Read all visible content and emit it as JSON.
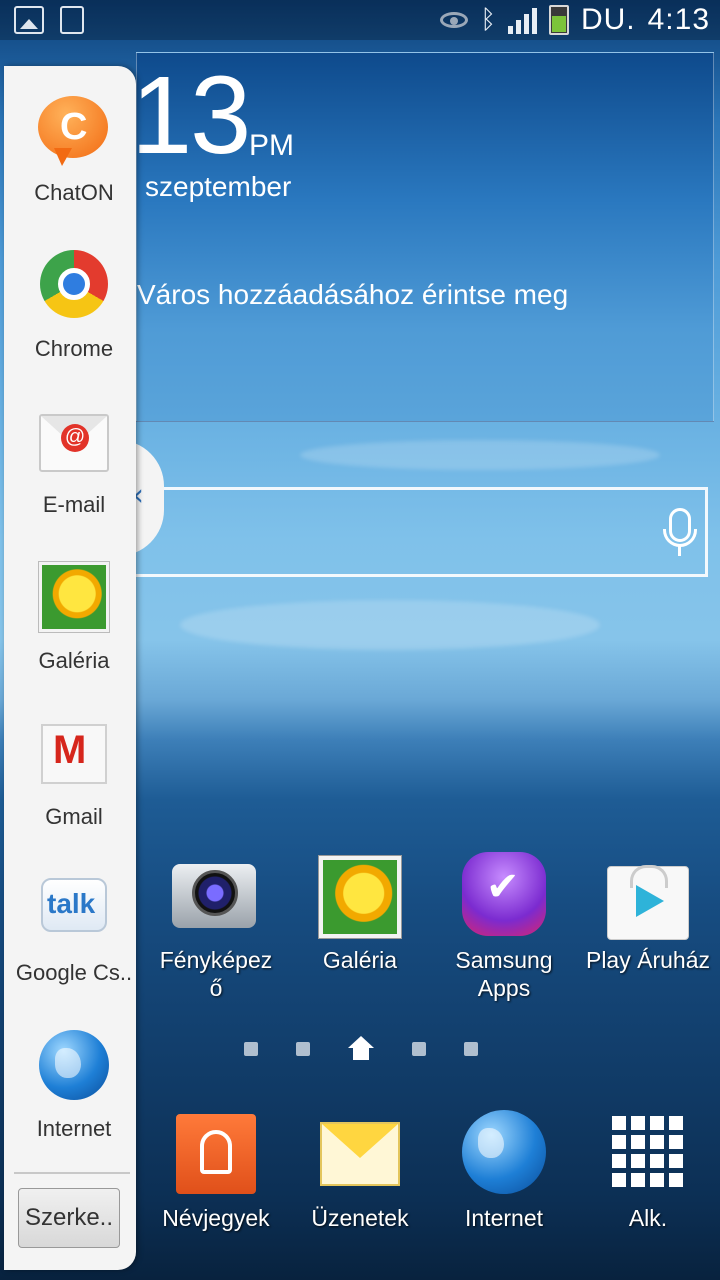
{
  "status_bar": {
    "left_icons": [
      "image-icon",
      "sd-card-icon"
    ],
    "right_icons": [
      "eye-icon",
      "bluetooth-icon",
      "signal-icon",
      "battery-icon"
    ],
    "ampm": "DU.",
    "time": "4:13"
  },
  "clock_widget": {
    "time": "13",
    "ampm": "PM",
    "date": "szeptember",
    "city_prompt": "Város hozzáadásához érintse meg"
  },
  "search_widget": {
    "mic_icon": "microphone-icon"
  },
  "side_dock": {
    "items": [
      {
        "label": "ChatON",
        "icon": "chaton-icon"
      },
      {
        "label": "Chrome",
        "icon": "chrome-icon"
      },
      {
        "label": "E-mail",
        "icon": "email-icon"
      },
      {
        "label": "Galéria",
        "icon": "gallery-icon"
      },
      {
        "label": "Gmail",
        "icon": "gmail-icon"
      },
      {
        "label": "Google Cs..",
        "icon": "google-talk-icon"
      },
      {
        "label": "Internet",
        "icon": "internet-icon"
      }
    ],
    "edit_label": "Szerke..",
    "collapse_glyph": "‹"
  },
  "home_apps": [
    {
      "label": "Fényképez\nő",
      "label_line1": "Fényképez",
      "label_line2": "ő",
      "icon": "camera-icon"
    },
    {
      "label": "Galéria",
      "icon": "gallery-icon"
    },
    {
      "label_line1": "Samsung",
      "label_line2": "Apps",
      "icon": "samsung-apps-icon"
    },
    {
      "label": "Play Áruház",
      "icon": "play-store-icon"
    }
  ],
  "page_indicator": {
    "count": 5,
    "current": "home"
  },
  "hotseat": [
    {
      "label": "Névjegyek",
      "icon": "contacts-icon"
    },
    {
      "label": "Üzenetek",
      "icon": "messages-icon"
    },
    {
      "label": "Internet",
      "icon": "internet-icon"
    },
    {
      "label": "Alk.",
      "icon": "apps-grid-icon"
    }
  ]
}
